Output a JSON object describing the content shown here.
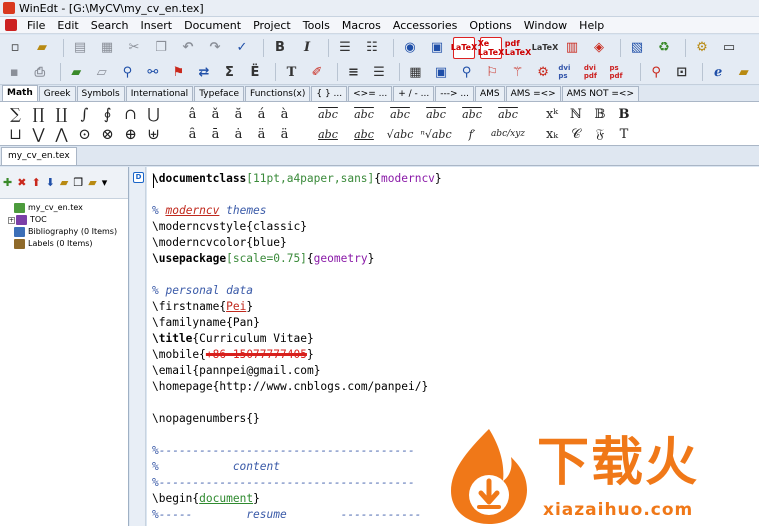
{
  "window": {
    "title": "WinEdt - [G:\\MyCV\\my_cv_en.tex]"
  },
  "menu": [
    "File",
    "Edit",
    "Search",
    "Insert",
    "Document",
    "Project",
    "Tools",
    "Macros",
    "Accessories",
    "Options",
    "Window",
    "Help"
  ],
  "toolbar": {
    "latex_label": "LaTeX",
    "xelatex_label": "Xe LaTeX",
    "pdflatex_label": "pdf LaTeX",
    "dvips_label": "dvi ps",
    "dvipdf_label": "dvi pdf",
    "pspdf_label": "ps pdf",
    "bold_label": "B",
    "italic_label": "I",
    "typewriter_label": "T",
    "sum_label": "Σ",
    "ddot_label": "Ë"
  },
  "symbol_tabs": [
    "Math",
    "Greek",
    "Symbols",
    "International",
    "Typeface",
    "Functions(x)",
    "{ } ...",
    "<>= ...",
    "+ / - ...",
    "---> ...",
    "AMS",
    "AMS =<>",
    "AMS NOT =<>"
  ],
  "symbols": {
    "big_ops_row1": [
      "∑",
      "∏",
      "∐",
      "∫",
      "∮",
      "∩",
      "⋃"
    ],
    "big_ops_row2": [
      "⊔",
      "⋁",
      "⋀",
      "⊙",
      "⊗",
      "⊕",
      "⊎"
    ],
    "accents_row1": [
      "â",
      "ǎ",
      "ă",
      "á",
      "à"
    ],
    "accents_row2": [
      "ȃ",
      "ā",
      "ȧ",
      "ä",
      "ä"
    ],
    "wide_row1": [
      "abc",
      "abc",
      "abc",
      "abc",
      "abc",
      "abc"
    ],
    "wide_row2": [
      "abc",
      "abc",
      "√abc",
      "ⁿ√abc",
      "f′",
      "abc/xyz"
    ],
    "misc_row1": [
      "xᵏ",
      "ℕ",
      "𝔹",
      "B"
    ],
    "misc_row2": [
      "xₖ",
      "𝒞",
      "𝔉",
      "T"
    ]
  },
  "doc_tab": "my_cv_en.tex",
  "tree": {
    "root": "my_cv_en.tex",
    "toc": "TOC",
    "bibliography": "Bibliography  (0 Items)",
    "labels": "Labels  (0 Items)"
  },
  "code": {
    "documentclass_cmd": "\\documentclass",
    "documentclass_opt": "[11pt,a4paper,sans]",
    "documentclass_arg": "moderncv",
    "themes_comment_pre": "% ",
    "themes_comment_word": "moderncv",
    "themes_comment_post": " themes",
    "style_cmd": "\\moderncvstyle",
    "style_arg": "classic",
    "color_cmd": "\\moderncvcolor",
    "color_arg": "blue",
    "usepackage_cmd": "\\usepackage",
    "usepackage_opt": "[scale=0.75]",
    "usepackage_arg": "geometry",
    "personal_comment": "% personal data",
    "firstname_cmd": "\\firstname",
    "firstname_arg": "Pei",
    "familyname_cmd": "\\familyname",
    "familyname_arg": "Pan",
    "title_cmd": "\\title",
    "title_arg": "Curriculum Vitae",
    "mobile_cmd": "\\mobile",
    "mobile_arg": "+86-15077777405",
    "email_cmd": "\\email",
    "email_arg": "pannpei@gmail.com",
    "homepage_cmd": "\\homepage",
    "homepage_arg": "http://www.cnblogs.com/panpei/",
    "nopagenumbers": "\\nopagenumbers{}",
    "sep1": "%--------------------------------------",
    "content_comment": "%           content",
    "sep2": "%--------------------------------------",
    "begin_cmd": "\\begin",
    "begin_arg": "document",
    "resume_comment": "%-----        resume        ------------"
  },
  "watermark": {
    "cn_text": "下载火",
    "url": "xiazaihuo.com"
  }
}
